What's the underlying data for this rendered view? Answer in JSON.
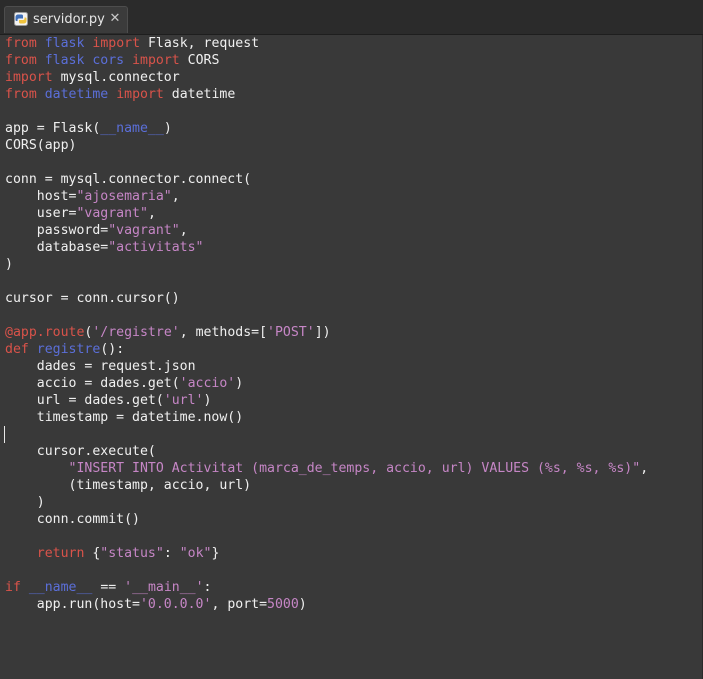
{
  "tab": {
    "filename": "servidor.py",
    "close_glyph": "✕",
    "icon": "python-file-icon"
  },
  "colors": {
    "keyword": "#d9534a",
    "module": "#5b6fd9",
    "string": "#c686c6",
    "text": "#f0f0f0",
    "background": "#393939"
  },
  "code": {
    "lines": [
      [
        {
          "t": "from",
          "c": "kw"
        },
        {
          "t": " "
        },
        {
          "t": "flask",
          "c": "mod"
        },
        {
          "t": " "
        },
        {
          "t": "import",
          "c": "kw"
        },
        {
          "t": " Flask, request"
        }
      ],
      [
        {
          "t": "from",
          "c": "kw"
        },
        {
          "t": " "
        },
        {
          "t": "flask cors",
          "c": "mod"
        },
        {
          "t": " "
        },
        {
          "t": "import",
          "c": "kw"
        },
        {
          "t": " CORS"
        }
      ],
      [
        {
          "t": "import",
          "c": "kw"
        },
        {
          "t": " mysql.connector"
        }
      ],
      [
        {
          "t": "from",
          "c": "kw"
        },
        {
          "t": " "
        },
        {
          "t": "datetime",
          "c": "mod"
        },
        {
          "t": " "
        },
        {
          "t": "import",
          "c": "kw"
        },
        {
          "t": " datetime"
        }
      ],
      [],
      [
        {
          "t": "app = Flask("
        },
        {
          "t": "__name__",
          "c": "dunder"
        },
        {
          "t": ")"
        }
      ],
      [
        {
          "t": "CORS(app)"
        }
      ],
      [],
      [
        {
          "t": "conn = mysql.connector.connect("
        }
      ],
      [
        {
          "t": "    host="
        },
        {
          "t": "\"ajosemaria\"",
          "c": "str"
        },
        {
          "t": ","
        }
      ],
      [
        {
          "t": "    user="
        },
        {
          "t": "\"vagrant\"",
          "c": "str"
        },
        {
          "t": ","
        }
      ],
      [
        {
          "t": "    password="
        },
        {
          "t": "\"vagrant\"",
          "c": "str"
        },
        {
          "t": ","
        }
      ],
      [
        {
          "t": "    database="
        },
        {
          "t": "\"activitats\"",
          "c": "str"
        }
      ],
      [
        {
          "t": ")"
        }
      ],
      [],
      [
        {
          "t": "cursor = conn.cursor()"
        }
      ],
      [],
      [
        {
          "t": "@app.route",
          "c": "dec"
        },
        {
          "t": "("
        },
        {
          "t": "'/registre'",
          "c": "str"
        },
        {
          "t": ", methods=["
        },
        {
          "t": "'POST'",
          "c": "str"
        },
        {
          "t": "])"
        }
      ],
      [
        {
          "t": "def",
          "c": "kw"
        },
        {
          "t": " "
        },
        {
          "t": "registre",
          "c": "fn"
        },
        {
          "t": "():"
        }
      ],
      [
        {
          "t": "    dades = request.json"
        }
      ],
      [
        {
          "t": "    accio = dades.get("
        },
        {
          "t": "'accio'",
          "c": "str"
        },
        {
          "t": ")"
        }
      ],
      [
        {
          "t": "    url = dades.get("
        },
        {
          "t": "'url'",
          "c": "str"
        },
        {
          "t": ")"
        }
      ],
      [
        {
          "t": "    timestamp = datetime.now()"
        }
      ],
      [],
      [
        {
          "t": "    cursor.execute("
        }
      ],
      [
        {
          "t": "        "
        },
        {
          "t": "\"INSERT INTO Activitat (marca_de_temps, accio, url) VALUES (%s, %s, %s)\"",
          "c": "str"
        },
        {
          "t": ","
        }
      ],
      [
        {
          "t": "        (timestamp, accio, url)"
        }
      ],
      [
        {
          "t": "    )"
        }
      ],
      [
        {
          "t": "    conn.commit()"
        }
      ],
      [],
      [
        {
          "t": "    "
        },
        {
          "t": "return",
          "c": "kw"
        },
        {
          "t": " {"
        },
        {
          "t": "\"status\"",
          "c": "str"
        },
        {
          "t": ": "
        },
        {
          "t": "\"ok\"",
          "c": "str"
        },
        {
          "t": "}"
        }
      ],
      [],
      [
        {
          "t": "if",
          "c": "kw"
        },
        {
          "t": " "
        },
        {
          "t": "__name__",
          "c": "dunder"
        },
        {
          "t": " == "
        },
        {
          "t": "'__main__'",
          "c": "str"
        },
        {
          "t": ":"
        }
      ],
      [
        {
          "t": "    app.run(host="
        },
        {
          "t": "'0.0.0.0'",
          "c": "str"
        },
        {
          "t": ", port="
        },
        {
          "t": "5000",
          "c": "num"
        },
        {
          "t": ")"
        }
      ]
    ]
  }
}
